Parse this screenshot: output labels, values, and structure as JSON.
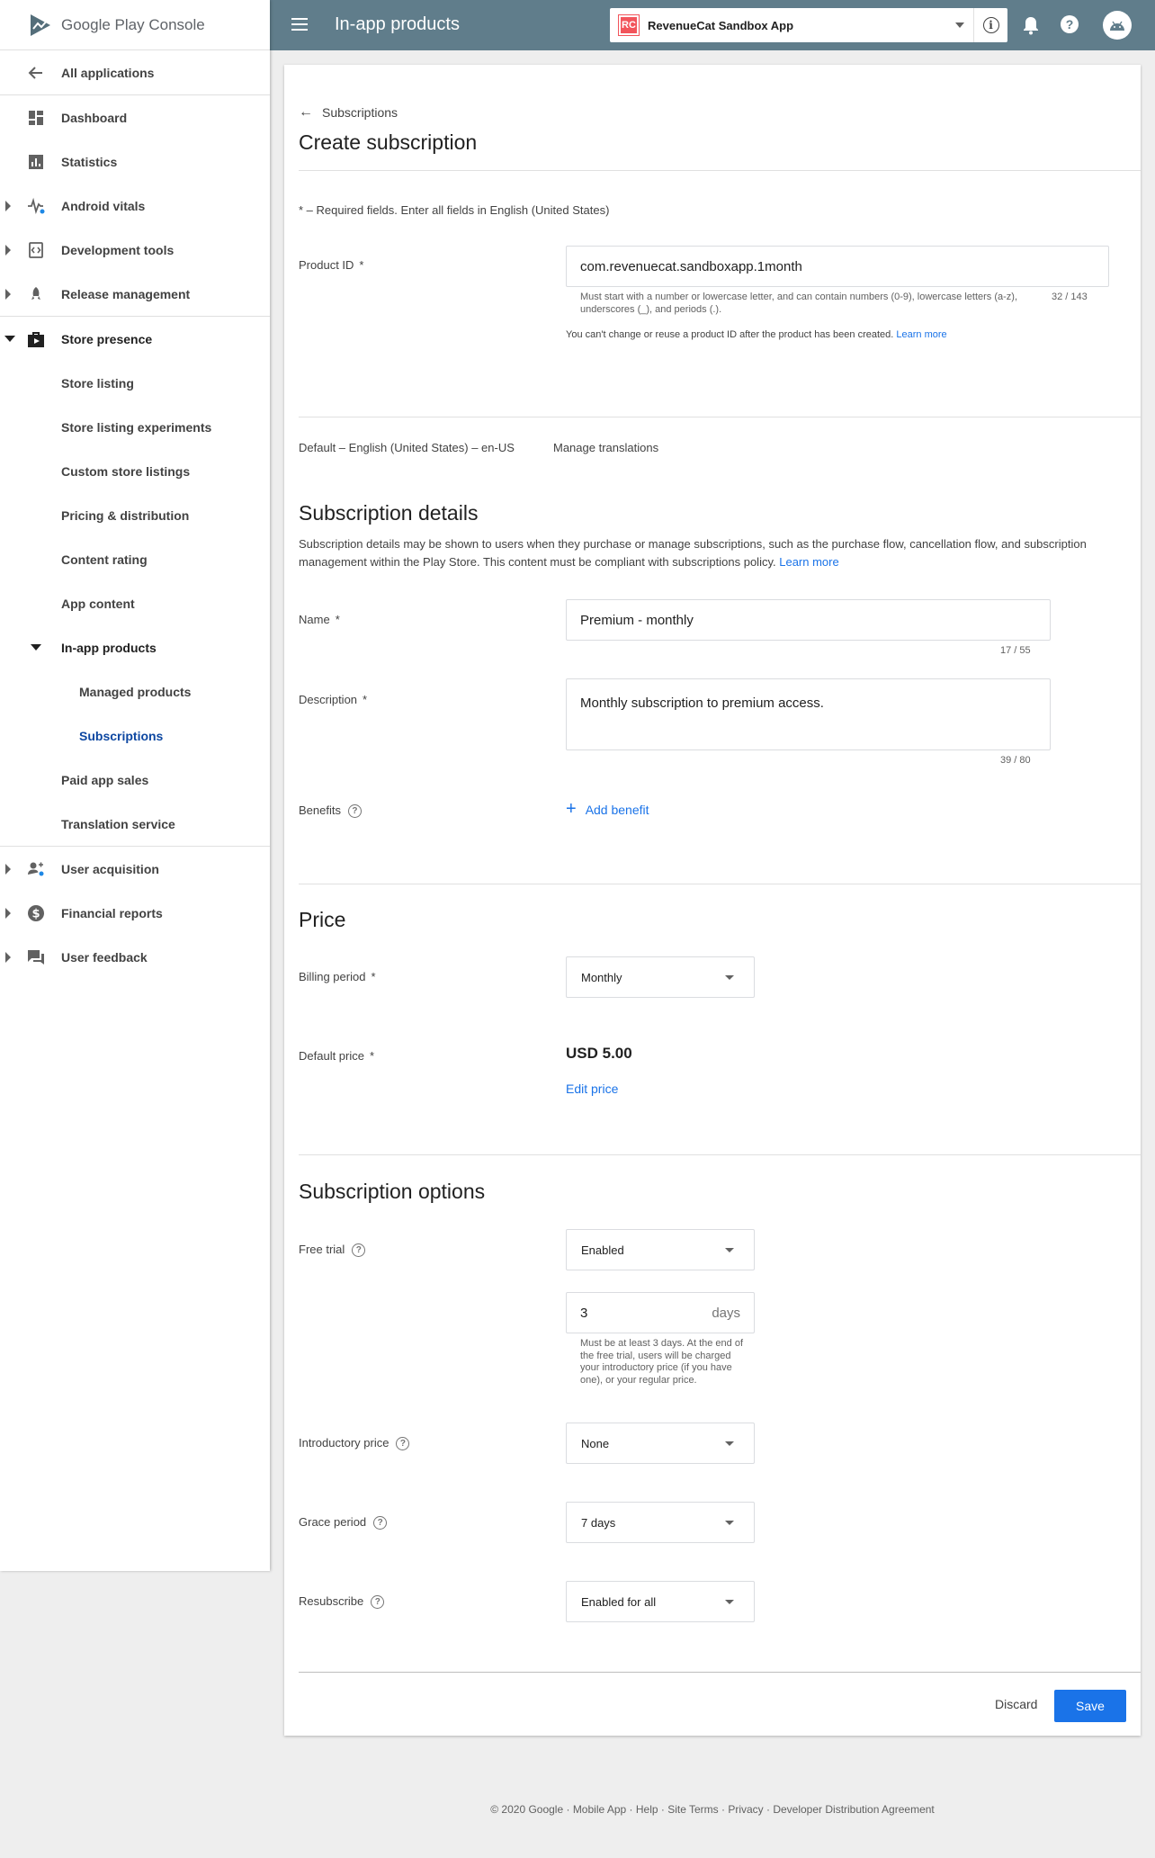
{
  "brand": {
    "google": "Google Play",
    "console": "Console"
  },
  "topbar": {
    "title": "In-app products",
    "app_name": "RevenueCat Sandbox App",
    "app_icon_text": "RC"
  },
  "sidebar": {
    "all_apps": "All applications",
    "items": [
      {
        "label": "Dashboard"
      },
      {
        "label": "Statistics"
      },
      {
        "label": "Android vitals"
      },
      {
        "label": "Development tools"
      },
      {
        "label": "Release management"
      },
      {
        "label": "Store presence"
      },
      {
        "label": "Store listing"
      },
      {
        "label": "Store listing experiments"
      },
      {
        "label": "Custom store listings"
      },
      {
        "label": "Pricing & distribution"
      },
      {
        "label": "Content rating"
      },
      {
        "label": "App content"
      },
      {
        "label": "In-app products"
      },
      {
        "label": "Managed products"
      },
      {
        "label": "Subscriptions"
      },
      {
        "label": "Paid app sales"
      },
      {
        "label": "Translation service"
      },
      {
        "label": "User acquisition"
      },
      {
        "label": "Financial reports"
      },
      {
        "label": "User feedback"
      }
    ]
  },
  "page": {
    "back_label": "Subscriptions",
    "title": "Create subscription",
    "required_note": "* – Required fields. Enter all fields in English (United States)",
    "product_id": {
      "label": "Product ID",
      "star": "*",
      "value": "com.revenuecat.sandboxapp.1month",
      "helper": "Must start with a number or lowercase letter, and can contain numbers (0-9), lowercase letters (a-z), underscores (_), and periods (.).",
      "counter": "32 / 143",
      "note": "You can't change or reuse a product ID after the product has been created.",
      "note_link": "Learn more"
    },
    "language": {
      "default": "Default – English (United States) – en-US",
      "manage": "Manage translations"
    },
    "details": {
      "title": "Subscription details",
      "text": "Subscription details may be shown to users when they purchase or manage subscriptions, such as the purchase flow, cancellation flow, and subscription management within the Play Store. This content must be compliant with subscriptions policy.",
      "link": "Learn more",
      "name_label": "Name",
      "name_value": "Premium - monthly",
      "name_counter": "17 / 55",
      "desc_label": "Description",
      "desc_value": "Monthly subscription to premium access.",
      "desc_counter": "39 / 80",
      "benefits_label": "Benefits",
      "add_benefit": "Add benefit"
    },
    "price": {
      "title": "Price",
      "billing_label": "Billing period",
      "billing_value": "Monthly",
      "default_label": "Default price",
      "default_value": "USD 5.00",
      "edit": "Edit price"
    },
    "options": {
      "title": "Subscription options",
      "free_trial_label": "Free trial",
      "free_trial_value": "Enabled",
      "days_value": "3",
      "days_suffix": "days",
      "trial_helper": "Must be at least 3 days. At the end of the free trial, users will be charged your introductory price (if you have one), or your regular price.",
      "intro_label": "Introductory price",
      "intro_value": "None",
      "grace_label": "Grace period",
      "grace_value": "7 days",
      "resub_label": "Resubscribe",
      "resub_value": "Enabled for all"
    },
    "actions": {
      "discard": "Discard",
      "save": "Save"
    }
  },
  "footer": "© 2020 Google · Mobile App · Help · Site Terms · Privacy · Developer Distribution Agreement",
  "colors": {
    "topbar": "#607d8b",
    "accent": "#1a73e8",
    "active_nav": "#0d47a1",
    "rc_brand": "#f2545b"
  }
}
